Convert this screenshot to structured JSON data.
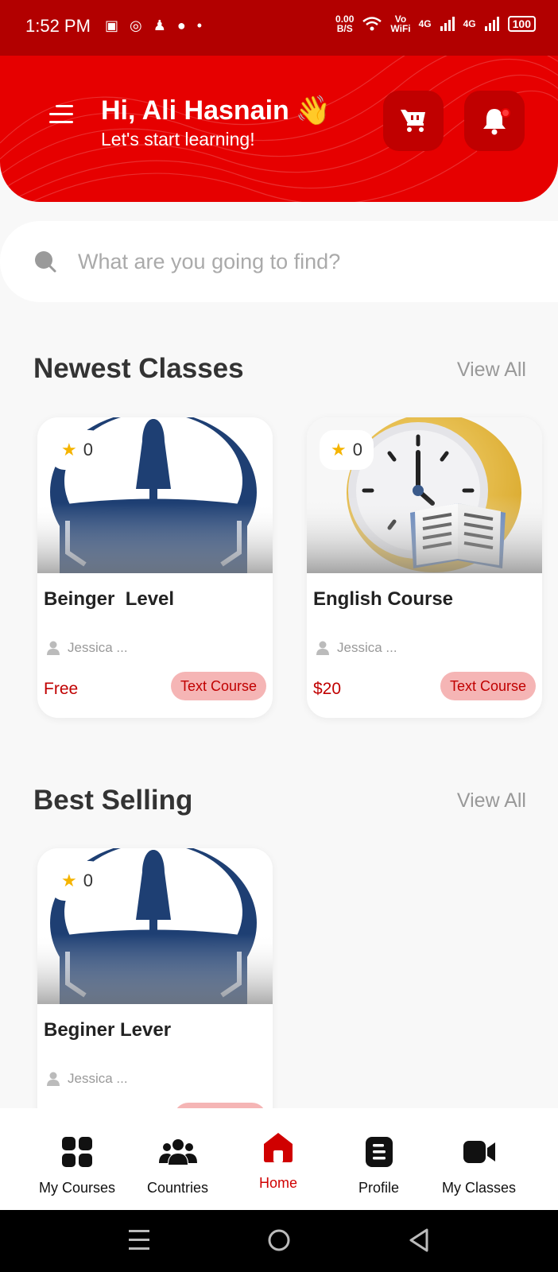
{
  "status_bar": {
    "time": "1:52 PM",
    "net_speed": "0.00\nB/S",
    "vowifi": "Vo\nWiFi",
    "sim1": "4G",
    "sim2": "4G",
    "battery": "100"
  },
  "header": {
    "greeting": "Hi, Ali Hasnain",
    "wave_emoji": "👋",
    "subtitle": "Let's start learning!",
    "accent_color": "#e60000"
  },
  "search": {
    "placeholder": "What are you going to find?"
  },
  "newest": {
    "title": "Newest Classes",
    "view_all": "View All",
    "cards": [
      {
        "rating": "0",
        "title": "Beinger  Level",
        "author": "Jessica ...",
        "price": "Free",
        "badge": "Text Course",
        "image": "bell-logo"
      },
      {
        "rating": "0",
        "title": "English Course",
        "author": "Jessica ...",
        "price": "$20",
        "badge": "Text Course",
        "image": "clock-book"
      }
    ]
  },
  "best_selling": {
    "title": "Best Selling",
    "view_all": "View All",
    "cards": [
      {
        "rating": "0",
        "title": "Beginer Lever",
        "author": "Jessica ...",
        "image": "bell-logo"
      }
    ]
  },
  "bottom_nav": {
    "items": [
      {
        "label": "My Courses",
        "icon": "grid-icon"
      },
      {
        "label": "Countries",
        "icon": "people-icon"
      },
      {
        "label": "Home",
        "icon": "home-icon",
        "active": true
      },
      {
        "label": "Profile",
        "icon": "document-icon"
      },
      {
        "label": "My Classes",
        "icon": "video-icon"
      }
    ]
  }
}
